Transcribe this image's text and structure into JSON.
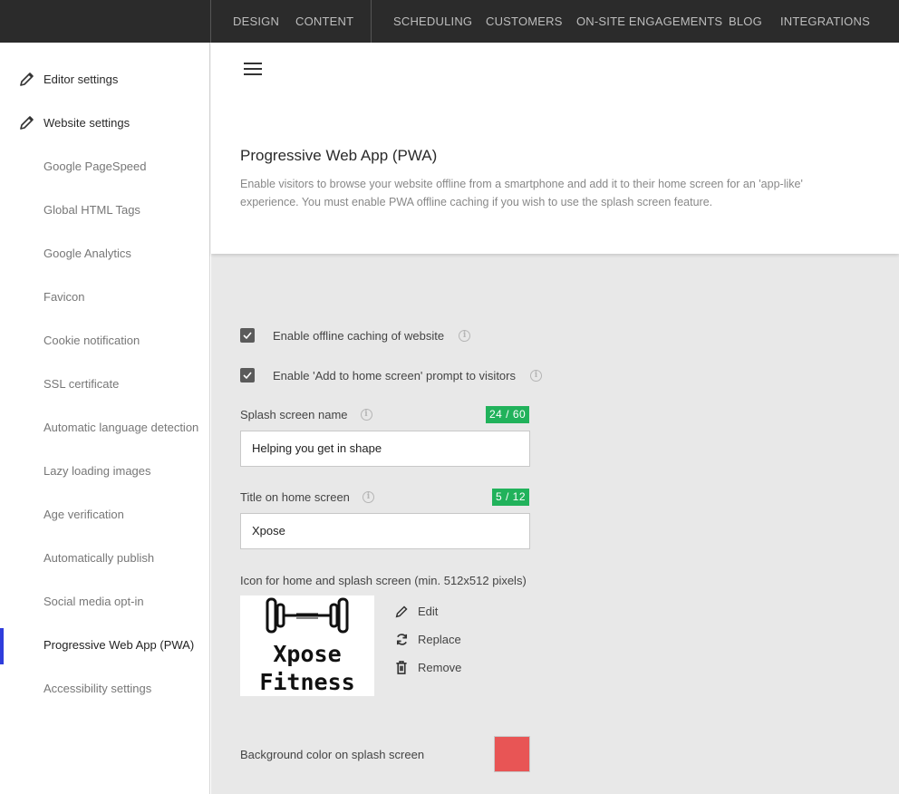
{
  "topnav": {
    "items": [
      {
        "label": "DESIGN"
      },
      {
        "label": "CONTENT"
      },
      {
        "label": "SCHEDULING"
      },
      {
        "label": "CUSTOMERS"
      },
      {
        "label": "ON-SITE ENGAGEMENTS"
      },
      {
        "label": "BLOG"
      },
      {
        "label": "INTEGRATIONS"
      }
    ]
  },
  "sidebar": {
    "items": [
      {
        "label": "Editor settings",
        "icon": "pencil-icon"
      },
      {
        "label": "Website settings",
        "icon": "pencil-icon"
      },
      {
        "label": "Google PageSpeed"
      },
      {
        "label": "Global HTML Tags"
      },
      {
        "label": "Google Analytics"
      },
      {
        "label": "Favicon"
      },
      {
        "label": "Cookie notification"
      },
      {
        "label": "SSL certificate"
      },
      {
        "label": "Automatic language detection"
      },
      {
        "label": "Lazy loading images"
      },
      {
        "label": "Age verification"
      },
      {
        "label": "Automatically publish"
      },
      {
        "label": "Social media opt-in"
      },
      {
        "label": "Progressive Web App (PWA)",
        "active": true
      },
      {
        "label": "Accessibility settings"
      }
    ]
  },
  "header": {
    "title": "Progressive Web App (PWA)",
    "description": "Enable visitors to browse your website offline from a smartphone and add it to their home screen for an 'app-like' experience. You must enable PWA offline caching if you wish to use the splash screen feature."
  },
  "settings": {
    "offline_caching": {
      "label": "Enable offline caching of website",
      "checked": true
    },
    "add_to_home": {
      "label": "Enable 'Add to home screen' prompt to visitors",
      "checked": true
    },
    "splash_name": {
      "label": "Splash screen name",
      "counter": "24 / 60",
      "value": "Helping you get in shape"
    },
    "home_title": {
      "label": "Title on home screen",
      "counter": "5 / 12",
      "value": "Xpose"
    },
    "icon": {
      "label": "Icon for home and splash screen (min. 512x512 pixels)",
      "logo_line1": "Xpose",
      "logo_line2": "Fitness",
      "actions": {
        "edit": "Edit",
        "replace": "Replace",
        "remove": "Remove"
      }
    },
    "bg_color": {
      "label": "Background color on splash screen",
      "color": "#e85555"
    }
  },
  "colors": {
    "accent": "#2f3ddc",
    "counter_green": "#21b25b"
  }
}
